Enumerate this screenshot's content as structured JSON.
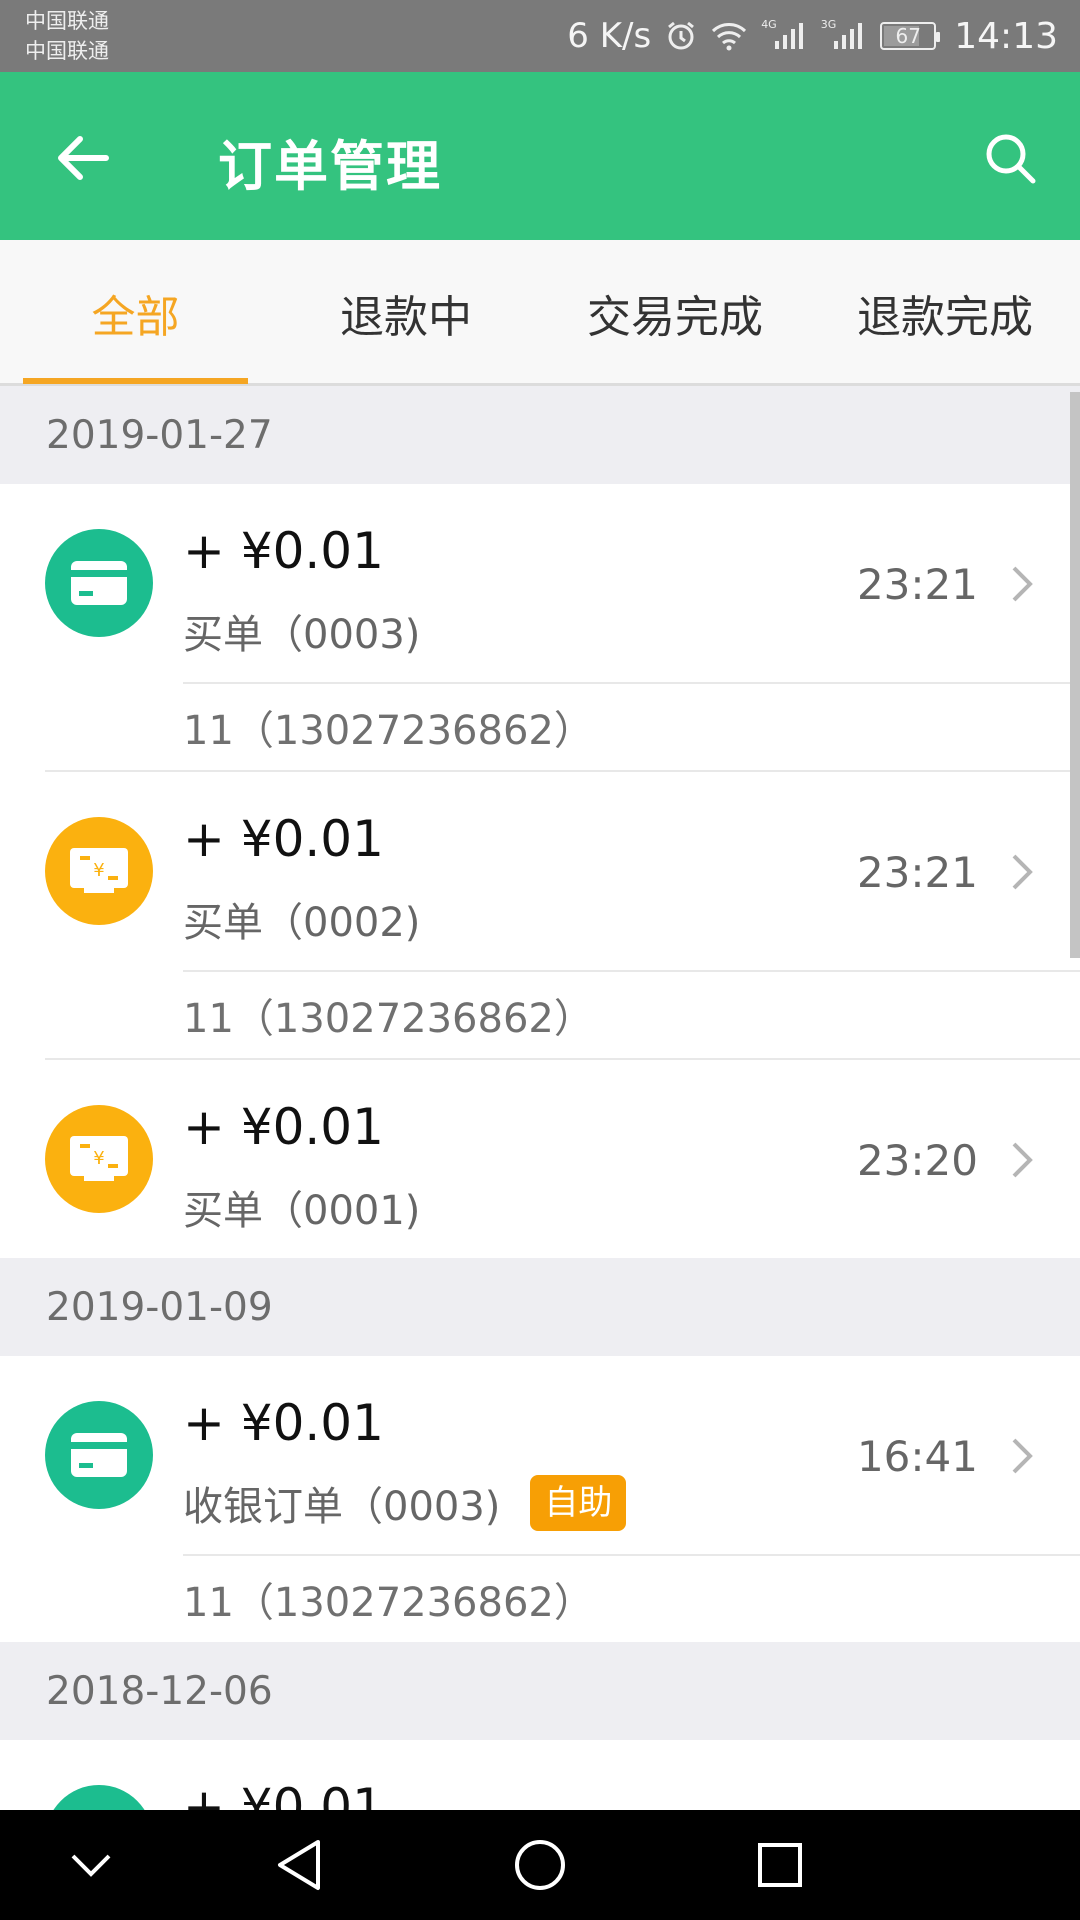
{
  "status_bar": {
    "carrier_1": "中国联通",
    "carrier_2": "中国联通",
    "net_speed": "6 K/s",
    "sig1_label": "4G",
    "sig2_label": "3G",
    "battery": "67",
    "time": "14:13"
  },
  "app_bar": {
    "title": "订单管理",
    "back_icon": "arrow-left-icon",
    "search_icon": "search-icon",
    "color": "#34c37f"
  },
  "tabs": [
    {
      "label": "全部",
      "active": true
    },
    {
      "label": "退款中",
      "active": false
    },
    {
      "label": "交易完成",
      "active": false
    },
    {
      "label": "退款完成",
      "active": false
    }
  ],
  "accent_color": "#f5a623",
  "groups": [
    {
      "date": "2019-01-27",
      "orders": [
        {
          "icon": "card-icon",
          "icon_color": "#1cbd8f",
          "amount": "+ ¥0.01",
          "desc": "买单（0003)",
          "time": "23:21",
          "customer": "11（13027236862）"
        },
        {
          "icon": "cash-register-icon",
          "icon_color": "#fbb10f",
          "amount": "+ ¥0.01",
          "desc": "买单（0002)",
          "time": "23:21",
          "customer": "11（13027236862）"
        },
        {
          "icon": "cash-register-icon",
          "icon_color": "#fbb10f",
          "amount": "+ ¥0.01",
          "desc": "买单（0001)",
          "time": "23:20"
        }
      ]
    },
    {
      "date": "2019-01-09",
      "orders": [
        {
          "icon": "card-icon",
          "icon_color": "#1cbd8f",
          "amount": "+ ¥0.01",
          "desc": "收银订单（0003)",
          "badge": "自助",
          "time": "16:41",
          "customer": "11（13027236862）"
        }
      ]
    },
    {
      "date": "2018-12-06",
      "orders": [
        {
          "icon": "card-icon",
          "icon_color": "#1cbd8f",
          "amount": "+ ¥0.01"
        }
      ]
    }
  ],
  "nav_bar": {
    "icons": [
      "chevron-down-icon",
      "back-triangle-icon",
      "home-circle-icon",
      "recents-square-icon"
    ]
  }
}
